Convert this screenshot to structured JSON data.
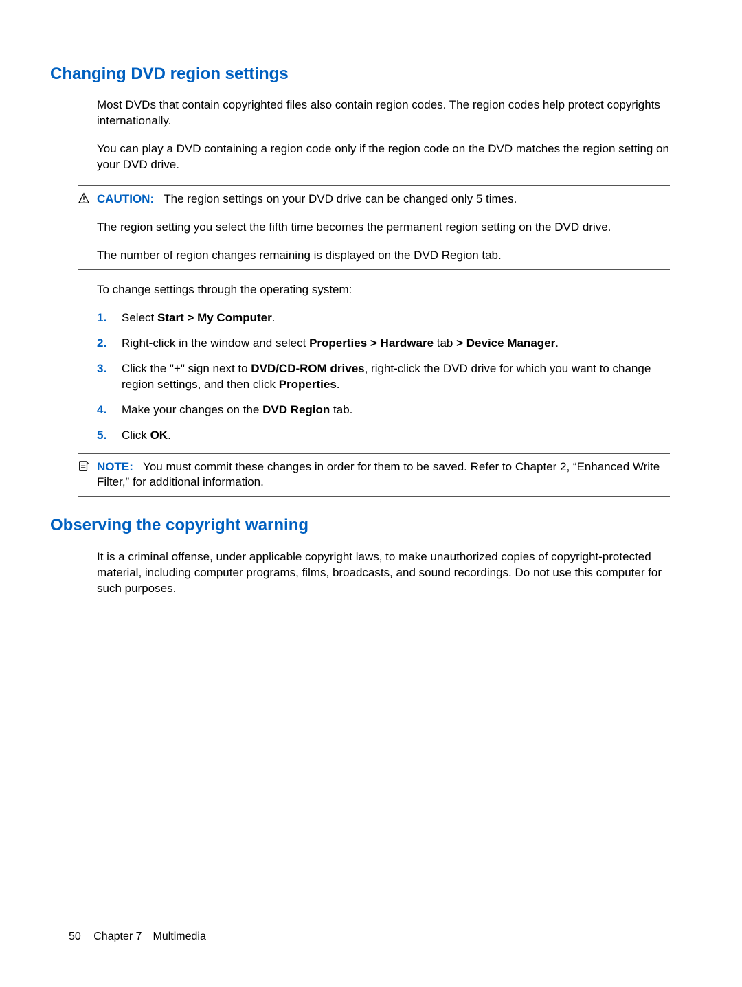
{
  "section1": {
    "heading": "Changing DVD region settings",
    "para1": "Most DVDs that contain copyrighted files also contain region codes. The region codes help protect copyrights internationally.",
    "para2": "You can play a DVD containing a region code only if the region code on the DVD matches the region setting on your DVD drive.",
    "caution": {
      "label": "CAUTION:",
      "line1": "The region settings on your DVD drive can be changed only 5 times.",
      "line2": "The region setting you select the fifth time becomes the permanent region setting on the DVD drive.",
      "line3": "The number of region changes remaining is displayed on the DVD Region tab."
    },
    "para3": "To change settings through the operating system:",
    "steps": [
      {
        "n": "1.",
        "pre": "Select ",
        "b1": "Start > My Computer",
        "post": "."
      },
      {
        "n": "2.",
        "pre": "Right-click in the window and select ",
        "b1": "Properties > Hardware",
        "mid": " tab ",
        "b2": "> Device Manager",
        "post": "."
      },
      {
        "n": "3.",
        "pre": "Click the \"+\" sign next to ",
        "b1": "DVD/CD-ROM drives",
        "mid": ", right-click the DVD drive for which you want to change region settings, and then click ",
        "b2": "Properties",
        "post": "."
      },
      {
        "n": "4.",
        "pre": "Make your changes on the ",
        "b1": "DVD Region",
        "post": " tab."
      },
      {
        "n": "5.",
        "pre": "Click ",
        "b1": "OK",
        "post": "."
      }
    ],
    "note": {
      "label": "NOTE:",
      "text": "You must commit these changes in order for them to be saved. Refer to Chapter 2, “Enhanced Write Filter,” for additional information."
    }
  },
  "section2": {
    "heading": "Observing the copyright warning",
    "para1": "It is a criminal offense, under applicable copyright laws, to make unauthorized copies of copyright-protected material, including computer programs, films, broadcasts, and sound recordings. Do not use this computer for such purposes."
  },
  "footer": {
    "page": "50",
    "chapter": "Chapter 7 Multimedia"
  }
}
